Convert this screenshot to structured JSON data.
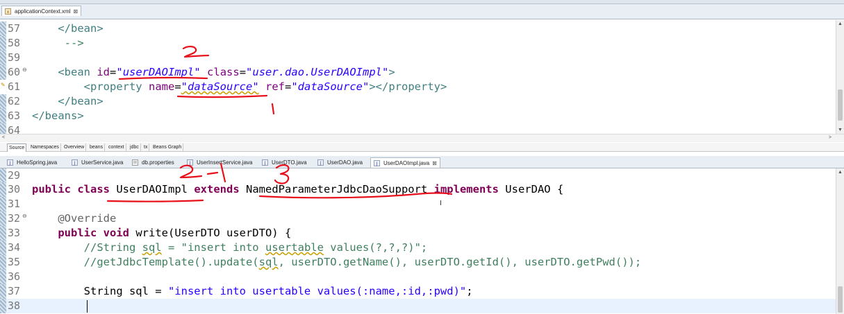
{
  "top_editor": {
    "tab_label": "applicationContext.xml",
    "tab_close": "⊠",
    "lines": [
      {
        "n": "57",
        "text": "    </bean>"
      },
      {
        "n": "58",
        "text": "     -->"
      },
      {
        "n": "59",
        "text": ""
      },
      {
        "n": "60",
        "text": "    <bean id=\"userDAOImpl\" class=\"user.dao.UserDAOImpl\">"
      },
      {
        "n": "61",
        "text": "        <property name=\"dataSource\" ref=\"dataSource\"></property>"
      },
      {
        "n": "62",
        "text": "    </bean>"
      },
      {
        "n": "63",
        "text": "</beans>"
      },
      {
        "n": "64",
        "text": ""
      }
    ],
    "xml_tabs": [
      "Source",
      "Namespaces",
      "Overview",
      "beans",
      "context",
      "jdbc",
      "tx",
      "Beans Graph"
    ]
  },
  "bottom_editor": {
    "tabs": [
      "HelloSpring.java",
      "UserService.java",
      "db.properties",
      "UserInsertService.java",
      "UserDTO.java",
      "UserDAO.java",
      "UserDAOImpl.java"
    ],
    "active_tab": "UserDAOImpl.java",
    "tab_close": "⊠",
    "lines": [
      {
        "n": "29",
        "text": ""
      },
      {
        "n": "30",
        "text": "public class UserDAOImpl extends NamedParameterJdbcDaoSupport implements UserDAO {"
      },
      {
        "n": "31",
        "text": ""
      },
      {
        "n": "32",
        "text": "    @Override"
      },
      {
        "n": "33",
        "text": "    public void write(UserDTO userDTO) {"
      },
      {
        "n": "34",
        "text": "        //String sql = \"insert into usertable values(?,?,?)\";"
      },
      {
        "n": "35",
        "text": "        //getJdbcTemplate().update(sql, userDTO.getName(), userDTO.getId(), userDTO.getPwd());"
      },
      {
        "n": "36",
        "text": ""
      },
      {
        "n": "37",
        "text": "        String sql = \"insert into usertable values(:name,:id,:pwd)\";"
      },
      {
        "n": "38",
        "text": ""
      }
    ]
  },
  "handwriting": {
    "top_marks": [
      "2",
      "1"
    ],
    "bottom_marks": [
      "2",
      "-1",
      "3"
    ]
  },
  "colors": {
    "keyword": "#7f0055",
    "comment": "#3f7f5f",
    "string": "#2a00ff",
    "xml_tag": "#3f7f7f",
    "xml_attr": "#7f007f",
    "annotation_ink": "#e8101a"
  }
}
